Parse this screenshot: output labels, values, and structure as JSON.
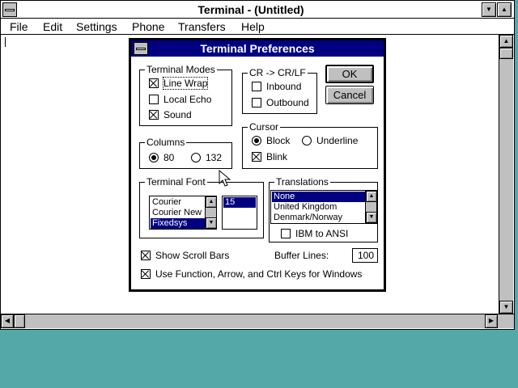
{
  "window": {
    "title": "Terminal - (Untitled)",
    "menu": [
      "File",
      "Edit",
      "Settings",
      "Phone",
      "Transfers",
      "Help"
    ],
    "minimize_glyph": "▼",
    "maximize_glyph": "▲"
  },
  "dialog": {
    "title": "Terminal Preferences",
    "terminal_modes": {
      "label": "Terminal Modes",
      "options": [
        {
          "label": "Line Wrap",
          "checked": true
        },
        {
          "label": "Local Echo",
          "checked": false
        },
        {
          "label": "Sound",
          "checked": true
        }
      ]
    },
    "crlf": {
      "label": "CR -> CR/LF",
      "options": [
        {
          "label": "Inbound",
          "checked": false
        },
        {
          "label": "Outbound",
          "checked": false
        }
      ]
    },
    "ok_label": "OK",
    "cancel_label": "Cancel",
    "columns": {
      "label": "Columns",
      "options": [
        {
          "label": "80",
          "selected": true
        },
        {
          "label": "132",
          "selected": false
        }
      ]
    },
    "cursor": {
      "label": "Cursor",
      "options": [
        {
          "label": "Block",
          "selected": true
        },
        {
          "label": "Underline",
          "selected": false
        }
      ],
      "blink": {
        "label": "Blink",
        "checked": true
      }
    },
    "terminal_font": {
      "label": "Terminal Font",
      "fonts": [
        "Courier",
        "Courier New",
        "Fixedsys"
      ],
      "selected_font": "Fixedsys",
      "sizes": [
        "15"
      ],
      "selected_size": "15"
    },
    "translations": {
      "label": "Translations",
      "items": [
        "None",
        "United Kingdom",
        "Denmark/Norway"
      ],
      "selected": "None",
      "ibm_to_ansi": {
        "label": "IBM to ANSI",
        "checked": false
      }
    },
    "show_scroll_bars": {
      "label": "Show Scroll Bars",
      "checked": true
    },
    "buffer_lines": {
      "label": "Buffer Lines:",
      "value": "100"
    },
    "use_function_keys": {
      "label": "Use Function, Arrow, and Ctrl Keys for Windows",
      "checked": true
    }
  },
  "glyphs": {
    "up": "▲",
    "down": "▼",
    "left": "◀",
    "right": "▶"
  }
}
